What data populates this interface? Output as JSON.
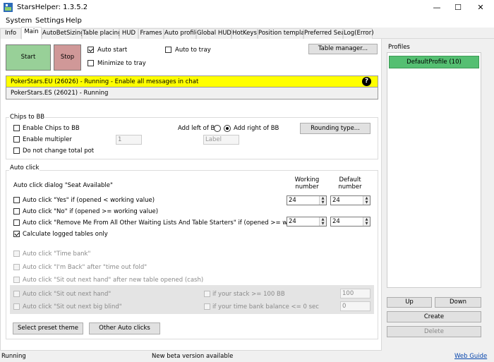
{
  "window": {
    "title": "StarsHelper: 1.3.5.2",
    "minimize": "—",
    "maximize": "☐",
    "close": "✕"
  },
  "menu": [
    "System",
    "Settings",
    "Help"
  ],
  "tabs": [
    "Info",
    "Main",
    "AutoBetSizing",
    "Table placing",
    "HUD",
    "Frames",
    "Auto profile",
    "Global HUD",
    "HotKeys",
    "Position template",
    "Preferred Seat",
    "Log(Error)"
  ],
  "active_tab": "Main",
  "main": {
    "start_label": "Start",
    "stop_label": "Stop",
    "auto_start_label": "Auto start",
    "minimize_to_tray_label": "Minimize to tray",
    "auto_to_tray_label": "Auto to tray",
    "table_manager_label": "Table manager...",
    "clients": [
      {
        "text": "PokerStars.EU (26026) - Running - Enable all messages in chat",
        "color": "#ffff00"
      },
      {
        "text": "PokerStars.ES (26021) - Running",
        "color": "#f0f0f0"
      }
    ],
    "help_icon": "?"
  },
  "chips": {
    "title": "Chips to BB",
    "enable_chips": "Enable Chips to BB",
    "enable_multiplier": "Enable multipler",
    "multiplier_value": "1",
    "no_change_pot": "Do not change total pot",
    "add_left": "Add left of BB",
    "add_right": "Add right of BB",
    "label_placeholder": "Label",
    "rounding_label": "Rounding type..."
  },
  "autoclick": {
    "title": "Auto click",
    "dialog_label": "Auto click dialog \"Seat Available\"",
    "working_number": "Working number",
    "default_number": "Default number",
    "yes_label": "Auto click \"Yes\" if (opened < working value)",
    "no_label": "Auto click \"No\" if (opened >= working value)",
    "remove_label": "Auto click \"Remove Me From All Other Waiting Lists And Table Starters\" if (opened >= working value)",
    "yes_working": "24",
    "yes_default": "24",
    "remove_working": "24",
    "remove_default": "24",
    "calc_logged": "Calculate logged tables only",
    "time_bank": "Auto click \"Time bank\"",
    "im_back": "Auto click \"I'm Back\" after \"time out fold\"",
    "sit_out_new": "Auto click \"Sit out next hand\" after new table opened (cash)",
    "sit_out_next": "Auto click \"Sit out next hand\"",
    "sit_out_bb": "Auto click \"Sit out next big blind\"",
    "stack_label": "if your stack >= 100 BB",
    "stack_value": "100",
    "timebank_label": "if your time bank balance <= 0 sec",
    "timebank_value": "0",
    "preset_label": "Select preset theme",
    "other_label": "Other Auto clicks"
  },
  "profiles": {
    "title": "Profiles",
    "items": [
      "DefaultProfile (10)"
    ],
    "up": "Up",
    "down": "Down",
    "create": "Create",
    "delete": "Delete"
  },
  "status": {
    "left": "Running",
    "center": "New beta version available",
    "link": "Web Guide"
  }
}
